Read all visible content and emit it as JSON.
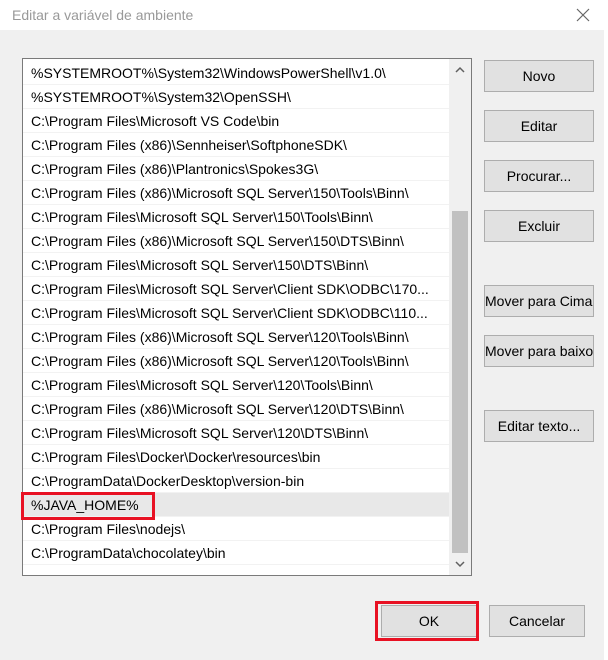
{
  "dialog": {
    "title": "Editar a variável de ambiente"
  },
  "paths": [
    "%SYSTEMROOT%\\System32\\WindowsPowerShell\\v1.0\\",
    "%SYSTEMROOT%\\System32\\OpenSSH\\",
    "C:\\Program Files\\Microsoft VS Code\\bin",
    "C:\\Program Files (x86)\\Sennheiser\\SoftphoneSDK\\",
    "C:\\Program Files (x86)\\Plantronics\\Spokes3G\\",
    "C:\\Program Files (x86)\\Microsoft SQL Server\\150\\Tools\\Binn\\",
    "C:\\Program Files\\Microsoft SQL Server\\150\\Tools\\Binn\\",
    "C:\\Program Files (x86)\\Microsoft SQL Server\\150\\DTS\\Binn\\",
    "C:\\Program Files\\Microsoft SQL Server\\150\\DTS\\Binn\\",
    "C:\\Program Files\\Microsoft SQL Server\\Client SDK\\ODBC\\170...",
    "C:\\Program Files\\Microsoft SQL Server\\Client SDK\\ODBC\\110...",
    "C:\\Program Files (x86)\\Microsoft SQL Server\\120\\Tools\\Binn\\",
    "C:\\Program Files (x86)\\Microsoft SQL Server\\120\\Tools\\Binn\\",
    "C:\\Program Files\\Microsoft SQL Server\\120\\Tools\\Binn\\",
    "C:\\Program Files (x86)\\Microsoft SQL Server\\120\\DTS\\Binn\\",
    "C:\\Program Files\\Microsoft SQL Server\\120\\DTS\\Binn\\",
    "C:\\Program Files\\Docker\\Docker\\resources\\bin",
    "C:\\ProgramData\\DockerDesktop\\version-bin",
    "%JAVA_HOME%",
    "C:\\Program Files\\nodejs\\",
    "C:\\ProgramData\\chocolatey\\bin"
  ],
  "selected_index": 18,
  "buttons": {
    "new": "Novo",
    "edit": "Editar",
    "browse": "Procurar...",
    "delete": "Excluir",
    "move_up": "Mover para Cima",
    "move_down": "Mover para baixo",
    "edit_text": "Editar texto...",
    "ok": "OK",
    "cancel": "Cancelar"
  },
  "icons": {
    "close": "close-icon",
    "scroll_up": "scroll-up-arrow-icon",
    "scroll_down": "scroll-down-arrow-icon"
  },
  "colors": {
    "highlight": "#e81123",
    "selection": "#e8e8e8"
  }
}
